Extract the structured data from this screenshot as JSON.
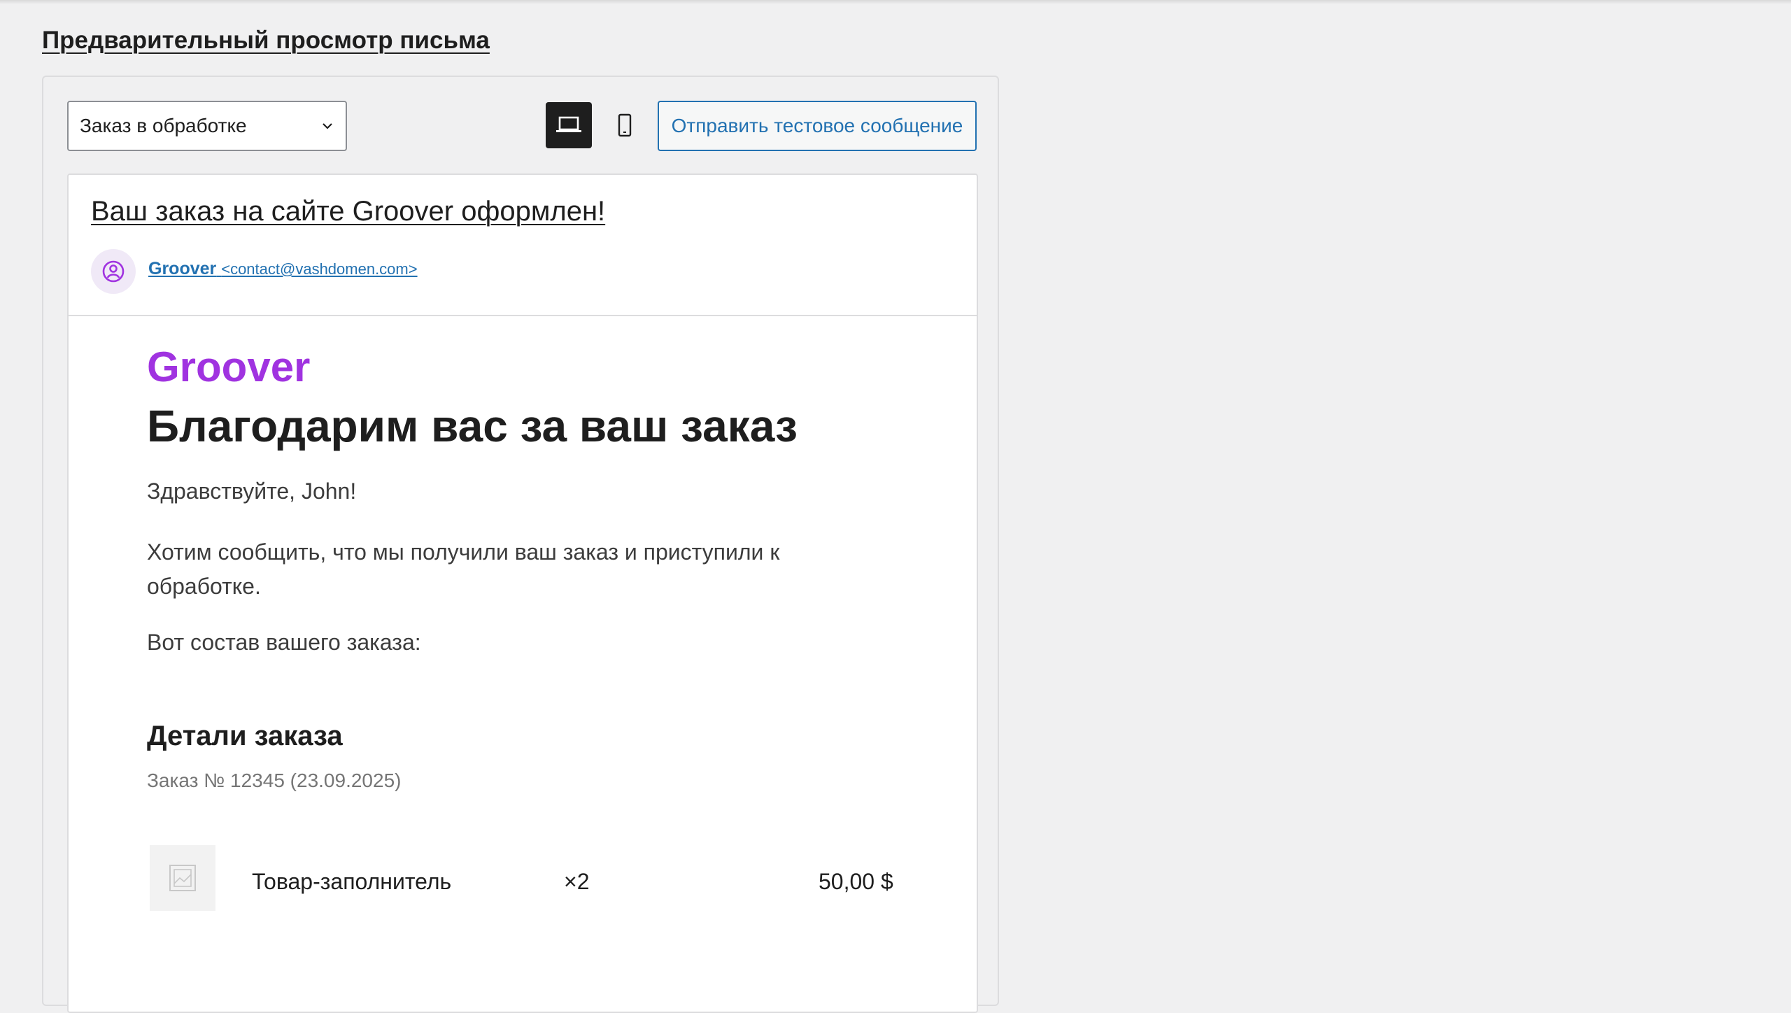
{
  "page": {
    "section_title": "Предварительный просмотр письма"
  },
  "toolbar": {
    "template_select_value": "Заказ в обработке",
    "send_test_label": "Отправить тестовое сообщение"
  },
  "email": {
    "subject": "Ваш заказ на сайте Groover оформлен!",
    "sender_name": "Groover",
    "sender_email": "<contact@vashdomen.com>",
    "brand": "Groover",
    "heading": "Благодарим вас за ваш заказ",
    "greeting": "Здравствуйте, John!",
    "message": "Хотим сообщить, что мы получили ваш заказ и приступили к обработке.",
    "contents_intro": "Вот состав вашего заказа:",
    "details_heading": "Детали заказа",
    "order_meta": "Заказ № 12345 (23.09.2025)",
    "items": [
      {
        "name": "Товар-заполнитель",
        "qty": "×2",
        "price": "50,00 $"
      }
    ]
  },
  "colors": {
    "accent": "#2271b1",
    "brand": "#a033e0",
    "avatar_bg": "#f0e9f7",
    "dark": "#1e1e1e"
  },
  "icons": {
    "select_chevron": "chevron-down-icon",
    "desktop_preview": "laptop-icon",
    "mobile_preview": "mobile-icon",
    "avatar": "user-circle-icon",
    "product_thumb": "image-placeholder-icon"
  }
}
